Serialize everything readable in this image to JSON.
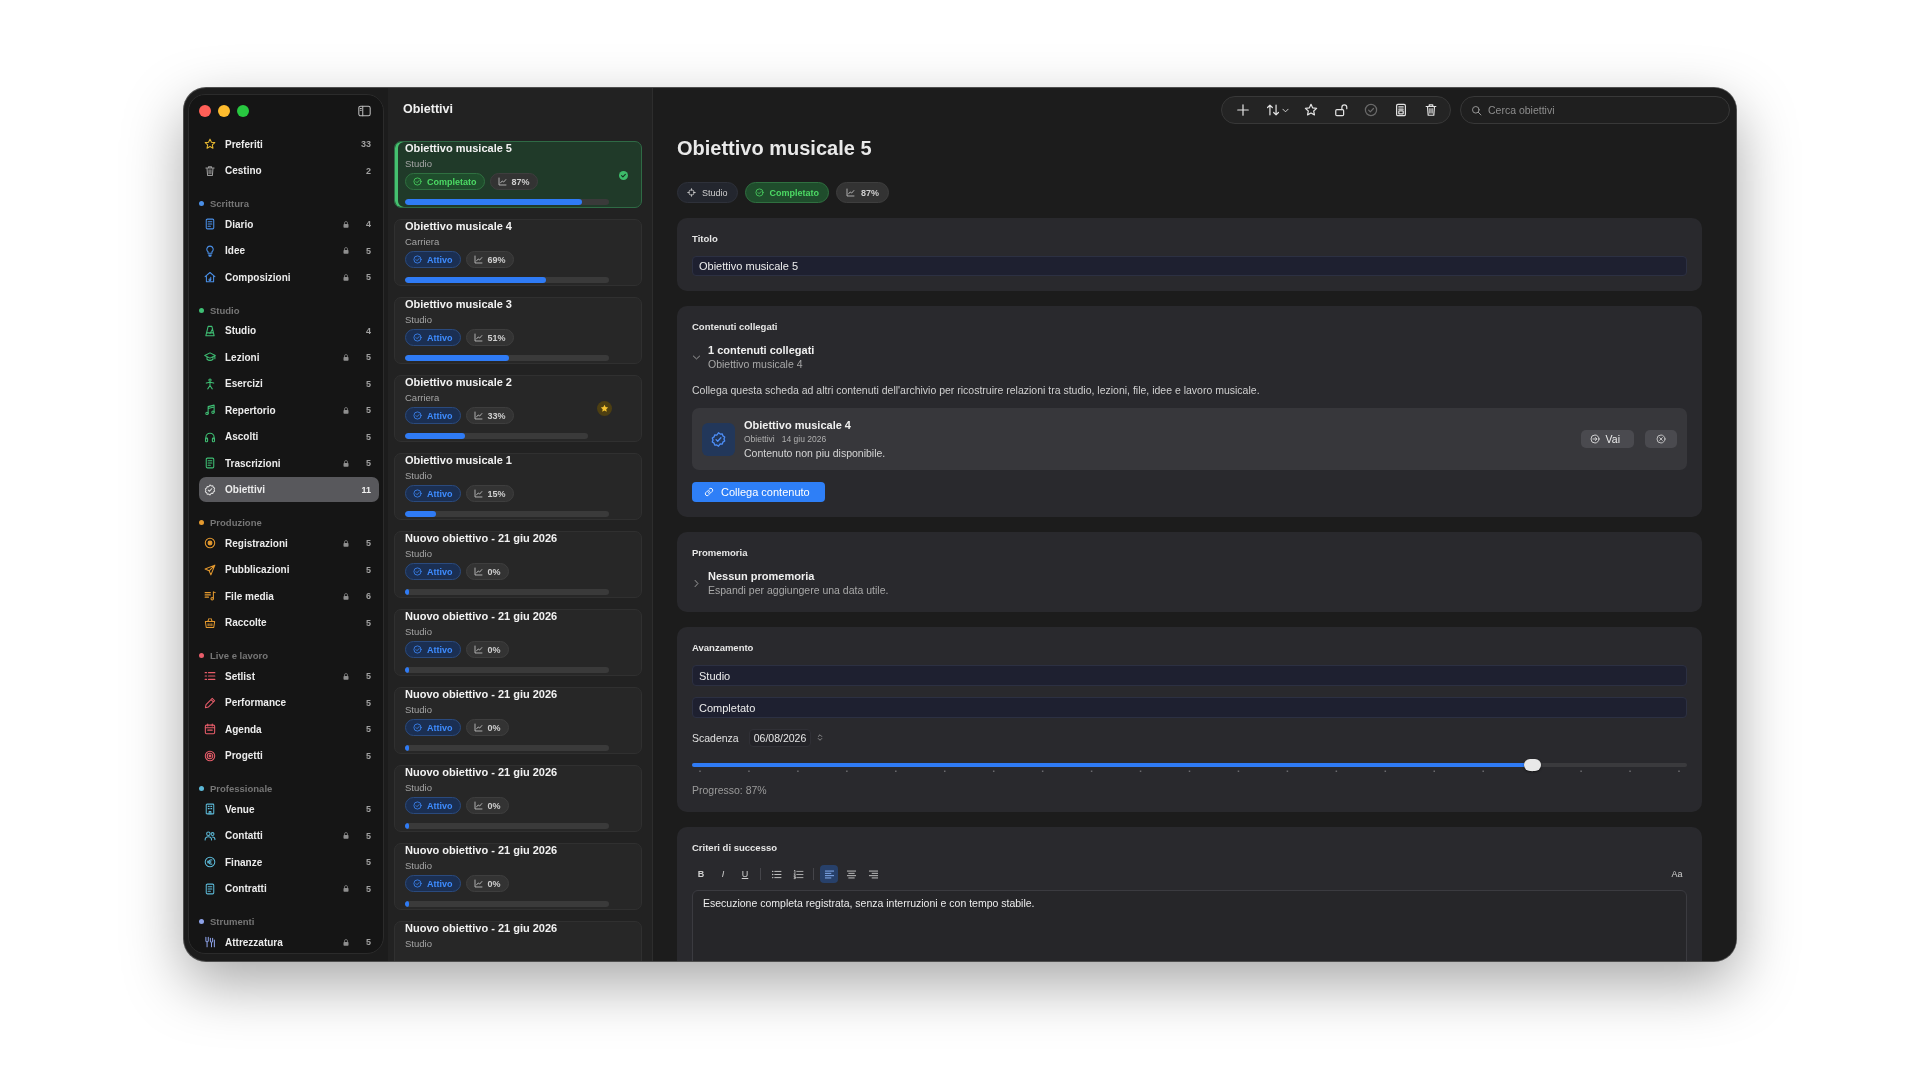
{
  "sidebar": {
    "pinned": [
      {
        "label": "Preferiti",
        "count": "33",
        "locked": false,
        "selected": false
      },
      {
        "label": "Cestino",
        "count": "2",
        "locked": false,
        "selected": false
      }
    ],
    "sections": [
      {
        "title": "Scrittura",
        "color": "#4a8fe7",
        "items": [
          {
            "label": "Diario",
            "count": "4",
            "locked": true,
            "selected": false
          },
          {
            "label": "Idee",
            "count": "5",
            "locked": true,
            "selected": false
          },
          {
            "label": "Composizioni",
            "count": "5",
            "locked": true,
            "selected": false
          }
        ]
      },
      {
        "title": "Studio",
        "color": "#3fbf74",
        "items": [
          {
            "label": "Studio",
            "count": "4",
            "locked": false,
            "selected": false
          },
          {
            "label": "Lezioni",
            "count": "5",
            "locked": true,
            "selected": false
          },
          {
            "label": "Esercizi",
            "count": "5",
            "locked": false,
            "selected": false
          },
          {
            "label": "Repertorio",
            "count": "5",
            "locked": true,
            "selected": false
          },
          {
            "label": "Ascolti",
            "count": "5",
            "locked": false,
            "selected": false
          },
          {
            "label": "Trascrizioni",
            "count": "5",
            "locked": true,
            "selected": false
          },
          {
            "label": "Obiettivi",
            "count": "11",
            "locked": false,
            "selected": true
          }
        ]
      },
      {
        "title": "Produzione",
        "color": "#e59a2f",
        "items": [
          {
            "label": "Registrazioni",
            "count": "5",
            "locked": true,
            "selected": false
          },
          {
            "label": "Pubblicazioni",
            "count": "5",
            "locked": false,
            "selected": false
          },
          {
            "label": "File media",
            "count": "6",
            "locked": true,
            "selected": false
          },
          {
            "label": "Raccolte",
            "count": "5",
            "locked": false,
            "selected": false
          }
        ]
      },
      {
        "title": "Live e lavoro",
        "color": "#e85d6a",
        "items": [
          {
            "label": "Setlist",
            "count": "5",
            "locked": true,
            "selected": false
          },
          {
            "label": "Performance",
            "count": "5",
            "locked": false,
            "selected": false
          },
          {
            "label": "Agenda",
            "count": "5",
            "locked": false,
            "selected": false
          },
          {
            "label": "Progetti",
            "count": "5",
            "locked": false,
            "selected": false
          }
        ]
      },
      {
        "title": "Professionale",
        "color": "#5cb8d6",
        "items": [
          {
            "label": "Venue",
            "count": "5",
            "locked": false,
            "selected": false
          },
          {
            "label": "Contatti",
            "count": "5",
            "locked": true,
            "selected": false
          },
          {
            "label": "Finanze",
            "count": "5",
            "locked": false,
            "selected": false
          },
          {
            "label": "Contratti",
            "count": "5",
            "locked": true,
            "selected": false
          }
        ]
      },
      {
        "title": "Strumenti",
        "color": "#8da2e8",
        "items": [
          {
            "label": "Attrezzatura",
            "count": "5",
            "locked": true,
            "selected": false
          }
        ]
      }
    ]
  },
  "list": {
    "title": "Obiettivi",
    "goals": [
      {
        "title": "Obiettivo musicale 5",
        "subtitle": "Studio",
        "pills": [
          {
            "kind": "completed",
            "label": "Completato"
          },
          {
            "kind": "progress",
            "label": "87%"
          }
        ],
        "level": 0.87,
        "selected": true,
        "starred": false,
        "done": true
      },
      {
        "title": "Obiettivo musicale 4",
        "subtitle": "Carriera",
        "pills": [
          {
            "kind": "active",
            "label": "Attivo"
          },
          {
            "kind": "progress",
            "label": "69%"
          }
        ],
        "level": 0.69,
        "selected": false,
        "starred": false,
        "done": false
      },
      {
        "title": "Obiettivo musicale 3",
        "subtitle": "Studio",
        "pills": [
          {
            "kind": "active",
            "label": "Attivo"
          },
          {
            "kind": "progress",
            "label": "51%"
          }
        ],
        "level": 0.51,
        "selected": false,
        "starred": false,
        "done": false
      },
      {
        "title": "Obiettivo musicale 2",
        "subtitle": "Carriera",
        "pills": [
          {
            "kind": "active",
            "label": "Attivo"
          },
          {
            "kind": "progress",
            "label": "33%"
          }
        ],
        "level": 0.33,
        "selected": false,
        "starred": true,
        "done": false
      },
      {
        "title": "Obiettivo musicale 1",
        "subtitle": "Studio",
        "pills": [
          {
            "kind": "active",
            "label": "Attivo"
          },
          {
            "kind": "progress",
            "label": "15%"
          }
        ],
        "level": 0.15,
        "selected": false,
        "starred": false,
        "done": false
      },
      {
        "title": "Nuovo obiettivo - 21 giu 2026",
        "subtitle": "Studio",
        "pills": [
          {
            "kind": "active",
            "label": "Attivo"
          },
          {
            "kind": "progress",
            "label": "0%"
          }
        ],
        "level": 0,
        "selected": false,
        "starred": false,
        "done": false
      },
      {
        "title": "Nuovo obiettivo - 21 giu 2026",
        "subtitle": "Studio",
        "pills": [
          {
            "kind": "active",
            "label": "Attivo"
          },
          {
            "kind": "progress",
            "label": "0%"
          }
        ],
        "level": 0,
        "selected": false,
        "starred": false,
        "done": false
      },
      {
        "title": "Nuovo obiettivo - 21 giu 2026",
        "subtitle": "Studio",
        "pills": [
          {
            "kind": "active",
            "label": "Attivo"
          },
          {
            "kind": "progress",
            "label": "0%"
          }
        ],
        "level": 0,
        "selected": false,
        "starred": false,
        "done": false
      },
      {
        "title": "Nuovo obiettivo - 21 giu 2026",
        "subtitle": "Studio",
        "pills": [
          {
            "kind": "active",
            "label": "Attivo"
          },
          {
            "kind": "progress",
            "label": "0%"
          }
        ],
        "level": 0,
        "selected": false,
        "starred": false,
        "done": false
      },
      {
        "title": "Nuovo obiettivo - 21 giu 2026",
        "subtitle": "Studio",
        "pills": [
          {
            "kind": "active",
            "label": "Attivo"
          },
          {
            "kind": "progress",
            "label": "0%"
          }
        ],
        "level": 0,
        "selected": false,
        "starred": false,
        "done": false
      },
      {
        "title": "Nuovo obiettivo - 21 giu 2026",
        "subtitle": "Studio",
        "selected": false,
        "starred": false,
        "done": false
      }
    ]
  },
  "toolbar": {
    "buttons": [
      {
        "disabled": false
      },
      {
        "disabled": false
      },
      {
        "disabled": false
      },
      {
        "disabled": false
      },
      {
        "disabled": true
      },
      {
        "disabled": false
      },
      {
        "disabled": false
      }
    ]
  },
  "search": {
    "placeholder": "Cerca obiettivi"
  },
  "detail": {
    "title": "Obiettivo musicale 5",
    "tags": [
      {
        "kind": "category",
        "label": "Studio"
      },
      {
        "kind": "completed",
        "label": "Completato"
      },
      {
        "kind": "progress",
        "label": "87%"
      }
    ],
    "title_field": {
      "label": "Titolo",
      "value": "Obiettivo musicale 5"
    },
    "linked": {
      "label": "Contenuti collegati",
      "expanded": true,
      "summary": "1 contenuti collegati",
      "summary_detail": "Obiettivo musicale 4",
      "description": "Collega questa scheda ad altri contenuti dell'archivio per ricostruire relazioni tra studio, lezioni, file, idee e lavoro musicale.",
      "items": [
        {
          "title": "Obiettivo musicale 4",
          "category": "Obiettivi",
          "date": "14 giu 2026",
          "note": "Contenuto non piu disponibile.",
          "action": "Vai"
        }
      ],
      "button": "Collega contenuto"
    },
    "reminders": {
      "label": "Promemoria",
      "expanded": false,
      "summary": "Nessun promemoria",
      "hint": "Espandi per aggiungere una data utile."
    },
    "progress": {
      "label": "Avanzamento",
      "fields": [
        {
          "value": "Studio"
        },
        {
          "value": "Completato"
        }
      ],
      "due_label": "Scadenza",
      "due_value": "06/08/2026",
      "slider": {
        "level": 0.85
      },
      "reading": "Progresso: 87%"
    },
    "criteria": {
      "label": "Criteri di successo",
      "format_buttons": [
        {
          "kind": "bold",
          "label": "B"
        },
        {
          "kind": "italic",
          "label": "I"
        },
        {
          "kind": "underline",
          "label": "U"
        }
      ],
      "alignments": [
        {
          "selected": true
        },
        {
          "selected": false
        },
        {
          "selected": false
        }
      ],
      "font_button": "Aa",
      "text": "Esecuzione completa registrata, senza interruzioni e con tempo stabile."
    }
  }
}
